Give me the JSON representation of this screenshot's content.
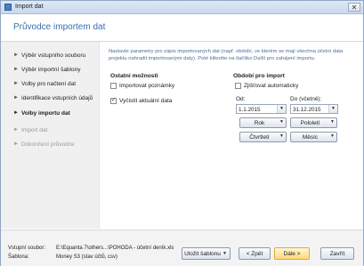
{
  "window": {
    "title": "Import dat",
    "close_glyph": "✕"
  },
  "header": {
    "title": "Průvodce importem dat"
  },
  "sidebar": {
    "steps": [
      {
        "label": "Výběr vstupního souboru"
      },
      {
        "label": "Výběr importní šablony"
      },
      {
        "label": "Volby pro načtení dat"
      },
      {
        "label": "Identifikace vstupních údajů"
      },
      {
        "label": "Volby importu dat"
      },
      {
        "label": "Import dat"
      },
      {
        "label": "Dokončení průvodce"
      }
    ],
    "bullet": "►"
  },
  "main": {
    "description": "Nastavte parametry pro zápis importovaných dat (např. období, ve kterém se mají všechna účetní data projektu nahradit importovanými daty). Poté klikněte na tlačítko Další pro zahájení importu.",
    "options": {
      "title": "Ostatní možnosti",
      "import_notes": {
        "label": "Importovat poznámky",
        "checked": false
      },
      "clear_data": {
        "label": "Vyčistit aktuální data",
        "checked": true
      }
    },
    "period": {
      "title": "Období pro import",
      "auto": {
        "label": "Zjišťovat automaticky",
        "checked": false
      },
      "from_label": "Od:",
      "from_value": "1.1.2015",
      "to_label": "Do (včetně):",
      "to_value": "31.12.2015",
      "buttons": {
        "year": "Rok",
        "half_year": "Pololetí",
        "quarter": "Čtvrtletí",
        "month": "Měsíc"
      }
    },
    "check_glyph": "✓",
    "dropdown_glyph": "▼"
  },
  "footer": {
    "input_file_label": "Vstupní soubor:",
    "input_file_value": "E:\\Equanta 7\\others...\\POHODA - účetní deník.xls",
    "template_label": "Šablona:",
    "template_value": "Money S3 (stav účtů, csv)",
    "save_template": "Uložit šablonu",
    "back": "< Zpět",
    "next": "Dále >",
    "close": "Zavřít"
  }
}
